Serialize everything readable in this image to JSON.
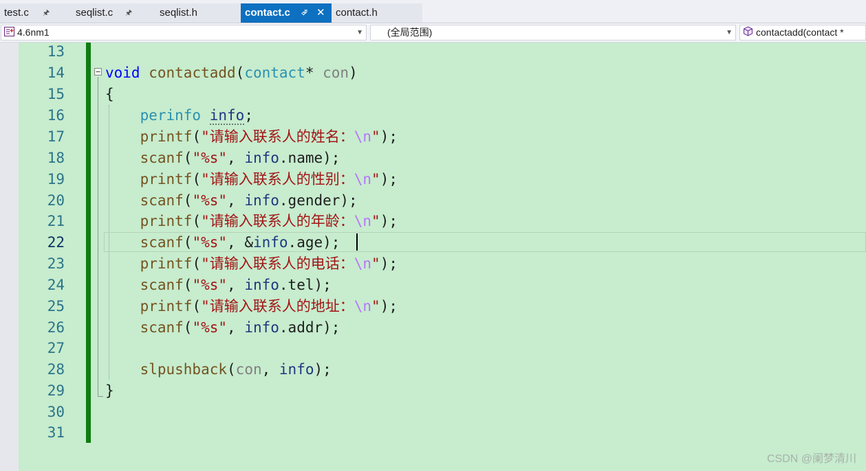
{
  "tabs": [
    {
      "label": "test.c",
      "pinned": true
    },
    {
      "label": "seqlist.c",
      "pinned": true
    },
    {
      "label": "seqlist.h",
      "pinned": false
    },
    {
      "label": "contact.c",
      "pinned": true,
      "active": true
    },
    {
      "label": "contact.h",
      "pinned": false
    }
  ],
  "nav": {
    "project": "4.6nm1",
    "scope": "(全局范围)",
    "member": "contactadd(contact *"
  },
  "editor": {
    "current_line": 22,
    "line_numbers": [
      "13",
      "14",
      "15",
      "16",
      "17",
      "18",
      "19",
      "20",
      "21",
      "22",
      "23",
      "24",
      "25",
      "26",
      "27",
      "28",
      "29",
      "30",
      "31"
    ],
    "code": {
      "l14_kw": "void",
      "l14_fn": "contactadd",
      "l14_ty": "contact",
      "l14_par": "con",
      "l15": "{",
      "l16_ty": "perinfo",
      "l16_var": "info",
      "fn_printf": "printf",
      "fn_scanf": "scanf",
      "fmt_str": "\"%s\"",
      "var_info": "info",
      "var_con": "con",
      "esc": "\\n",
      "prompt_name": "\"请输入联系人的姓名：",
      "prompt_gender": "\"请输入联系人的性别：",
      "prompt_age": "\"请输入联系人的年龄：",
      "prompt_tel": "\"请输入联系人的电话：",
      "prompt_addr": "\"请输入联系人的地址：",
      "field_name": ".name);",
      "field_gender": ".gender);",
      "field_age": ".age);",
      "field_tel": ".tel);",
      "field_addr": ".addr);",
      "l28_fn": "slpushback",
      "l29": "}"
    }
  },
  "watermark": "CSDN @阑梦清川",
  "colors": {
    "editor_bg": "#c7ecce",
    "active_tab": "#0e70c0",
    "change_bar": "#107c10",
    "keyword": "#0000ff",
    "string": "#a31515",
    "type": "#2b91af"
  }
}
